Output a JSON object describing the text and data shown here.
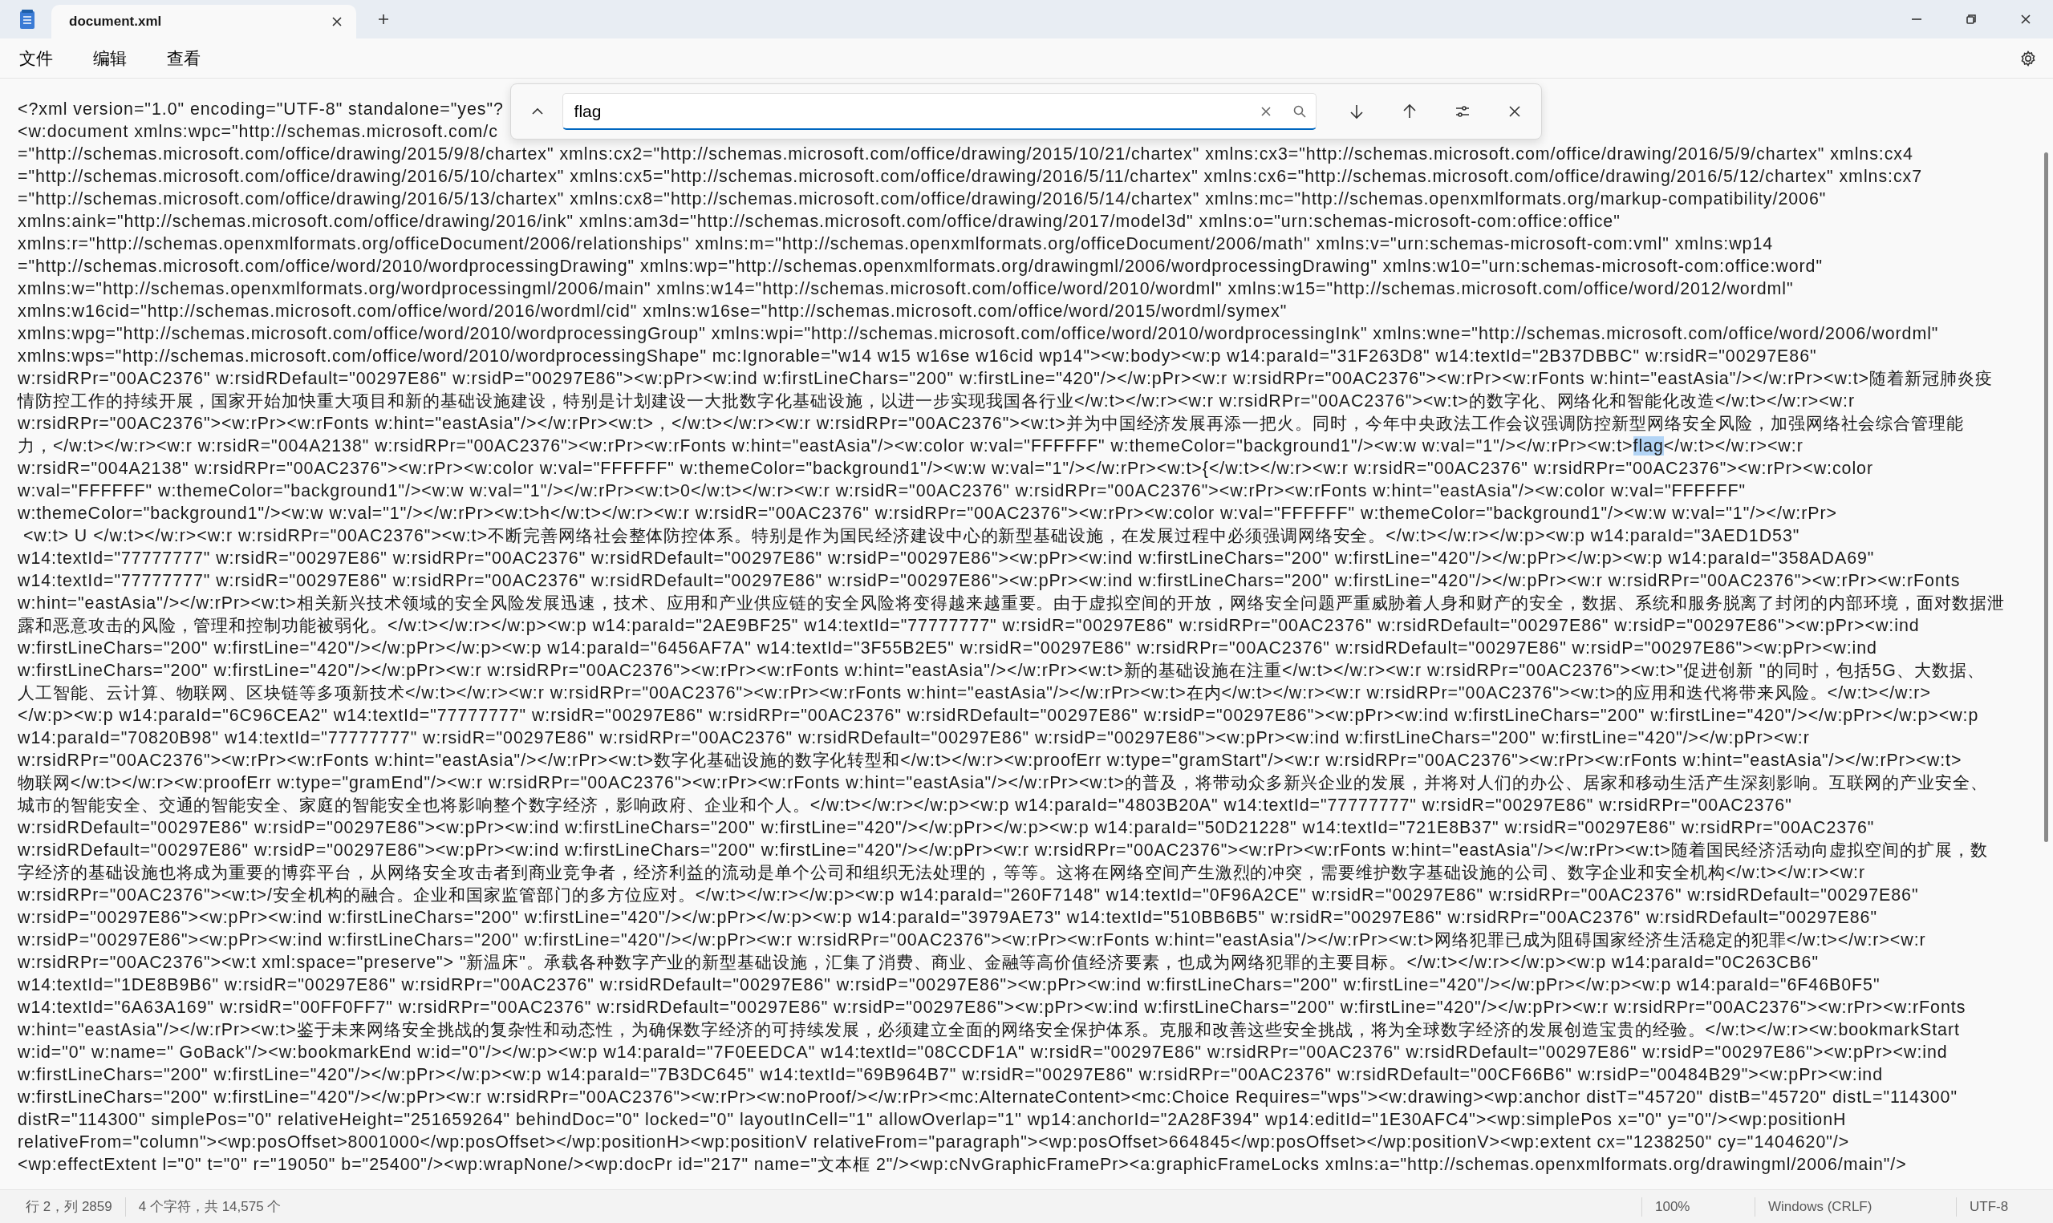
{
  "window": {
    "tab_title": "document.xml"
  },
  "menu": [
    "文件",
    "编辑",
    "查看"
  ],
  "find": {
    "value": "flag"
  },
  "lines": [
    {
      "text": "<?xml version=\"1.0\" encoding=\"UTF-8\" standalone=\"yes\"?"
    },
    {
      "text": "<w:document xmlns:wpc=\"http://schemas.microsoft.com/c"
    },
    {
      "text": "=\"http://schemas.microsoft.com/office/drawing/2015/9/8/chartex\" xmlns:cx2=\"http://schemas.microsoft.com/office/drawing/2015/10/21/chartex\" xmlns:cx3=\"http://schemas.microsoft.com/office/drawing/2016/5/9/chartex\" xmlns:cx4"
    },
    {
      "text": "=\"http://schemas.microsoft.com/office/drawing/2016/5/10/chartex\" xmlns:cx5=\"http://schemas.microsoft.com/office/drawing/2016/5/11/chartex\" xmlns:cx6=\"http://schemas.microsoft.com/office/drawing/2016/5/12/chartex\" xmlns:cx7"
    },
    {
      "text": "=\"http://schemas.microsoft.com/office/drawing/2016/5/13/chartex\" xmlns:cx8=\"http://schemas.microsoft.com/office/drawing/2016/5/14/chartex\" xmlns:mc=\"http://schemas.openxmlformats.org/markup-compatibility/2006\""
    },
    {
      "text": "xmlns:aink=\"http://schemas.microsoft.com/office/drawing/2016/ink\" xmlns:am3d=\"http://schemas.microsoft.com/office/drawing/2017/model3d\" xmlns:o=\"urn:schemas-microsoft-com:office:office\""
    },
    {
      "text": "xmlns:r=\"http://schemas.openxmlformats.org/officeDocument/2006/relationships\" xmlns:m=\"http://schemas.openxmlformats.org/officeDocument/2006/math\" xmlns:v=\"urn:schemas-microsoft-com:vml\" xmlns:wp14"
    },
    {
      "text": "=\"http://schemas.microsoft.com/office/word/2010/wordprocessingDrawing\" xmlns:wp=\"http://schemas.openxmlformats.org/drawingml/2006/wordprocessingDrawing\" xmlns:w10=\"urn:schemas-microsoft-com:office:word\""
    },
    {
      "text": "xmlns:w=\"http://schemas.openxmlformats.org/wordprocessingml/2006/main\" xmlns:w14=\"http://schemas.microsoft.com/office/word/2010/wordml\" xmlns:w15=\"http://schemas.microsoft.com/office/word/2012/wordml\""
    },
    {
      "text": "xmlns:w16cid=\"http://schemas.microsoft.com/office/word/2016/wordml/cid\" xmlns:w16se=\"http://schemas.microsoft.com/office/word/2015/wordml/symex\""
    },
    {
      "text": "xmlns:wpg=\"http://schemas.microsoft.com/office/word/2010/wordprocessingGroup\" xmlns:wpi=\"http://schemas.microsoft.com/office/word/2010/wordprocessingInk\" xmlns:wne=\"http://schemas.microsoft.com/office/word/2006/wordml\""
    },
    {
      "text": "xmlns:wps=\"http://schemas.microsoft.com/office/word/2010/wordprocessingShape\" mc:Ignorable=\"w14 w15 w16se w16cid wp14\"><w:body><w:p w14:paraId=\"31F263D8\" w14:textId=\"2B37DBBC\" w:rsidR=\"00297E86\""
    },
    {
      "text": "w:rsidRPr=\"00AC2376\" w:rsidRDefault=\"00297E86\" w:rsidP=\"00297E86\"><w:pPr><w:ind w:firstLineChars=\"200\" w:firstLine=\"420\"/></w:pPr><w:r w:rsidRPr=\"00AC2376\"><w:rPr><w:rFonts w:hint=\"eastAsia\"/></w:rPr><w:t>随着新冠肺炎疫"
    },
    {
      "text": "情防控工作的持续开展，国家开始加快重大项目和新的基础设施建设，特别是计划建设一大批数字化基础设施，以进一步实现我国各行业</w:t></w:r><w:r w:rsidRPr=\"00AC2376\"><w:t>的数字化、网络化和智能化改造</w:t></w:r><w:r"
    },
    {
      "text": "w:rsidRPr=\"00AC2376\"><w:rPr><w:rFonts w:hint=\"eastAsia\"/></w:rPr><w:t>，</w:t></w:r><w:r w:rsidRPr=\"00AC2376\"><w:t>并为中国经济发展再添一把火。同时，今年中央政法工作会议强调防控新型网络安全风险，加强网络社会综合管理能"
    },
    {
      "text": "力，</w:t></w:r><w:r w:rsidR=\"004A2138\" w:rsidRPr=\"00AC2376\"><w:rPr><w:rFonts w:hint=\"eastAsia\"/><w:color w:val=\"FFFFFF\" w:themeColor=\"background1\"/><w:w w:val=\"1\"/></w:rPr><w:t>",
      "match": "flag",
      "rest": "</w:t></w:r><w:r"
    },
    {
      "text": "w:rsidR=\"004A2138\" w:rsidRPr=\"00AC2376\"><w:rPr><w:color w:val=\"FFFFFF\" w:themeColor=\"background1\"/><w:w w:val=\"1\"/></w:rPr><w:t>{</w:t></w:r><w:r w:rsidR=\"00AC2376\" w:rsidRPr=\"00AC2376\"><w:rPr><w:color"
    },
    {
      "text": "w:val=\"FFFFFF\" w:themeColor=\"background1\"/><w:w w:val=\"1\"/></w:rPr><w:t>0</w:t></w:r><w:r w:rsidR=\"00AC2376\" w:rsidRPr=\"00AC2376\"><w:rPr><w:rFonts w:hint=\"eastAsia\"/><w:color w:val=\"FFFFFF\""
    },
    {
      "text": "w:themeColor=\"background1\"/><w:w w:val=\"1\"/></w:rPr><w:t>h</w:t></w:r><w:r w:rsidR=\"00AC2376\" w:rsidRPr=\"00AC2376\"><w:rPr><w:color w:val=\"FFFFFF\" w:themeColor=\"background1\"/><w:w w:val=\"1\"/></w:rPr>"
    },
    {
      "text": " <w:t> U </w:t></w:r><w:r w:rsidRPr=\"00AC2376\"><w:t>不断完善网络社会整体防控体系。特别是作为国民经济建设中心的新型基础设施，在发展过程中必须强调网络安全。</w:t></w:r></w:p><w:p w14:paraId=\"3AED1D53\""
    },
    {
      "text": "w14:textId=\"77777777\" w:rsidR=\"00297E86\" w:rsidRPr=\"00AC2376\" w:rsidRDefault=\"00297E86\" w:rsidP=\"00297E86\"><w:pPr><w:ind w:firstLineChars=\"200\" w:firstLine=\"420\"/></w:pPr></w:p><w:p w14:paraId=\"358ADA69\""
    },
    {
      "text": "w14:textId=\"77777777\" w:rsidR=\"00297E86\" w:rsidRPr=\"00AC2376\" w:rsidRDefault=\"00297E86\" w:rsidP=\"00297E86\"><w:pPr><w:ind w:firstLineChars=\"200\" w:firstLine=\"420\"/></w:pPr><w:r w:rsidRPr=\"00AC2376\"><w:rPr><w:rFonts"
    },
    {
      "text": "w:hint=\"eastAsia\"/></w:rPr><w:t>相关新兴技术领域的安全风险发展迅速，技术、应用和产业供应链的安全风险将变得越来越重要。由于虚拟空间的开放，网络安全问题严重威胁着人身和财产的安全，数据、系统和服务脱离了封闭的内部环境，面对数据泄"
    },
    {
      "text": "露和恶意攻击的风险，管理和控制功能被弱化。</w:t></w:r></w:p><w:p w14:paraId=\"2AE9BF25\" w14:textId=\"77777777\" w:rsidR=\"00297E86\" w:rsidRPr=\"00AC2376\" w:rsidRDefault=\"00297E86\" w:rsidP=\"00297E86\"><w:pPr><w:ind"
    },
    {
      "text": "w:firstLineChars=\"200\" w:firstLine=\"420\"/></w:pPr></w:p><w:p w14:paraId=\"6456AF7A\" w14:textId=\"3F55B2E5\" w:rsidR=\"00297E86\" w:rsidRPr=\"00AC2376\" w:rsidRDefault=\"00297E86\" w:rsidP=\"00297E86\"><w:pPr><w:ind"
    },
    {
      "text": "w:firstLineChars=\"200\" w:firstLine=\"420\"/></w:pPr><w:r w:rsidRPr=\"00AC2376\"><w:rPr><w:rFonts w:hint=\"eastAsia\"/></w:rPr><w:t>新的基础设施在注重</w:t></w:r><w:r w:rsidRPr=\"00AC2376\"><w:t>\"促进创新 \"的同时，包括5G、大数据、"
    },
    {
      "text": "人工智能、云计算、物联网、区块链等多项新技术</w:t></w:r><w:r w:rsidRPr=\"00AC2376\"><w:rPr><w:rFonts w:hint=\"eastAsia\"/></w:rPr><w:t>在内</w:t></w:r><w:r w:rsidRPr=\"00AC2376\"><w:t>的应用和迭代将带来风险。</w:t></w:r>"
    },
    {
      "text": "</w:p><w:p w14:paraId=\"6C96CEA2\" w14:textId=\"77777777\" w:rsidR=\"00297E86\" w:rsidRPr=\"00AC2376\" w:rsidRDefault=\"00297E86\" w:rsidP=\"00297E86\"><w:pPr><w:ind w:firstLineChars=\"200\" w:firstLine=\"420\"/></w:pPr></w:p><w:p"
    },
    {
      "text": "w14:paraId=\"70820B98\" w14:textId=\"77777777\" w:rsidR=\"00297E86\" w:rsidRPr=\"00AC2376\" w:rsidRDefault=\"00297E86\" w:rsidP=\"00297E86\"><w:pPr><w:ind w:firstLineChars=\"200\" w:firstLine=\"420\"/></w:pPr><w:r"
    },
    {
      "text": "w:rsidRPr=\"00AC2376\"><w:rPr><w:rFonts w:hint=\"eastAsia\"/></w:rPr><w:t>数字化基础设施的数字化转型和</w:t></w:r><w:proofErr w:type=\"gramStart\"/><w:r w:rsidRPr=\"00AC2376\"><w:rPr><w:rFonts w:hint=\"eastAsia\"/></w:rPr><w:t>"
    },
    {
      "text": "物联网</w:t></w:r><w:proofErr w:type=\"gramEnd\"/><w:r w:rsidRPr=\"00AC2376\"><w:rPr><w:rFonts w:hint=\"eastAsia\"/></w:rPr><w:t>的普及，将带动众多新兴企业的发展，并将对人们的办公、居家和移动生活产生深刻影响。互联网的产业安全、"
    },
    {
      "text": "城市的智能安全、交通的智能安全、家庭的智能安全也将影响整个数字经济，影响政府、企业和个人。</w:t></w:r></w:p><w:p w14:paraId=\"4803B20A\" w14:textId=\"77777777\" w:rsidR=\"00297E86\" w:rsidRPr=\"00AC2376\""
    },
    {
      "text": "w:rsidRDefault=\"00297E86\" w:rsidP=\"00297E86\"><w:pPr><w:ind w:firstLineChars=\"200\" w:firstLine=\"420\"/></w:pPr></w:p><w:p w14:paraId=\"50D21228\" w14:textId=\"721E8B37\" w:rsidR=\"00297E86\" w:rsidRPr=\"00AC2376\""
    },
    {
      "text": "w:rsidRDefault=\"00297E86\" w:rsidP=\"00297E86\"><w:pPr><w:ind w:firstLineChars=\"200\" w:firstLine=\"420\"/></w:pPr><w:r w:rsidRPr=\"00AC2376\"><w:rPr><w:rFonts w:hint=\"eastAsia\"/></w:rPr><w:t>随着国民经济活动向虚拟空间的扩展，数"
    },
    {
      "text": "字经济的基础设施也将成为重要的博弈平台，从网络安全攻击者到商业竞争者，经济利益的流动是单个公司和组织无法处理的，等等。这将在网络空间产生激烈的冲突，需要维护数字基础设施的公司、数字企业和安全机构</w:t></w:r><w:r"
    },
    {
      "text": "w:rsidRPr=\"00AC2376\"><w:t>/安全机构的融合。企业和国家监管部门的多方位应对。</w:t></w:r></w:p><w:p w14:paraId=\"260F7148\" w14:textId=\"0F96A2CE\" w:rsidR=\"00297E86\" w:rsidRPr=\"00AC2376\" w:rsidRDefault=\"00297E86\""
    },
    {
      "text": "w:rsidP=\"00297E86\"><w:pPr><w:ind w:firstLineChars=\"200\" w:firstLine=\"420\"/></w:pPr></w:p><w:p w14:paraId=\"3979AE73\" w14:textId=\"510BB6B5\" w:rsidR=\"00297E86\" w:rsidRPr=\"00AC2376\" w:rsidRDefault=\"00297E86\""
    },
    {
      "text": "w:rsidP=\"00297E86\"><w:pPr><w:ind w:firstLineChars=\"200\" w:firstLine=\"420\"/></w:pPr><w:r w:rsidRPr=\"00AC2376\"><w:rPr><w:rFonts w:hint=\"eastAsia\"/></w:rPr><w:t>网络犯罪已成为阻碍国家经济生活稳定的犯罪</w:t></w:r><w:r"
    },
    {
      "text": "w:rsidRPr=\"00AC2376\"><w:t xml:space=\"preserve\"> \"新温床\"。承载各种数字产业的新型基础设施，汇集了消费、商业、金融等高价值经济要素，也成为网络犯罪的主要目标。</w:t></w:r></w:p><w:p w14:paraId=\"0C263CB6\""
    },
    {
      "text": "w14:textId=\"1DE8B9B6\" w:rsidR=\"00297E86\" w:rsidRPr=\"00AC2376\" w:rsidRDefault=\"00297E86\" w:rsidP=\"00297E86\"><w:pPr><w:ind w:firstLineChars=\"200\" w:firstLine=\"420\"/></w:pPr></w:p><w:p w14:paraId=\"6F46B0F5\""
    },
    {
      "text": "w14:textId=\"6A63A169\" w:rsidR=\"00FF0FF7\" w:rsidRPr=\"00AC2376\" w:rsidRDefault=\"00297E86\" w:rsidP=\"00297E86\"><w:pPr><w:ind w:firstLineChars=\"200\" w:firstLine=\"420\"/></w:pPr><w:r w:rsidRPr=\"00AC2376\"><w:rPr><w:rFonts"
    },
    {
      "text": "w:hint=\"eastAsia\"/></w:rPr><w:t>鉴于未来网络安全挑战的复杂性和动态性，为确保数字经济的可持续发展，必须建立全面的网络安全保护体系。克服和改善这些安全挑战，将为全球数字经济的发展创造宝贵的经验。</w:t></w:r><w:bookmarkStart"
    },
    {
      "text": "w:id=\"0\" w:name=\" GoBack\"/><w:bookmarkEnd w:id=\"0\"/></w:p><w:p w14:paraId=\"7F0EEDCA\" w14:textId=\"08CCDF1A\" w:rsidR=\"00297E86\" w:rsidRPr=\"00AC2376\" w:rsidRDefault=\"00297E86\" w:rsidP=\"00297E86\"><w:pPr><w:ind"
    },
    {
      "text": "w:firstLineChars=\"200\" w:firstLine=\"420\"/></w:pPr></w:p><w:p w14:paraId=\"7B3DC645\" w14:textId=\"69B964B7\" w:rsidR=\"00297E86\" w:rsidRPr=\"00AC2376\" w:rsidRDefault=\"00CF66B6\" w:rsidP=\"00484B29\"><w:pPr><w:ind"
    },
    {
      "text": "w:firstLineChars=\"200\" w:firstLine=\"420\"/></w:pPr><w:r w:rsidRPr=\"00AC2376\"><w:rPr><w:noProof/></w:rPr><mc:AlternateContent><mc:Choice Requires=\"wps\"><w:drawing><wp:anchor distT=\"45720\" distB=\"45720\" distL=\"114300\""
    },
    {
      "text": "distR=\"114300\" simplePos=\"0\" relativeHeight=\"251659264\" behindDoc=\"0\" locked=\"0\" layoutInCell=\"1\" allowOverlap=\"1\" wp14:anchorId=\"2A28F394\" wp14:editId=\"1E30AFC4\"><wp:simplePos x=\"0\" y=\"0\"/><wp:positionH"
    },
    {
      "text": "relativeFrom=\"column\"><wp:posOffset>8001000</wp:posOffset></wp:positionH><wp:positionV relativeFrom=\"paragraph\"><wp:posOffset>664845</wp:posOffset></wp:positionV><wp:extent cx=\"1238250\" cy=\"1404620\"/>"
    },
    {
      "text": "<wp:effectExtent l=\"0\" t=\"0\" r=\"19050\" b=\"25400\"/><wp:wrapNone/><wp:docPr id=\"217\" name=\"文本框 2\"/><wp:cNvGraphicFramePr><a:graphicFrameLocks xmlns:a=\"http://schemas.openxmlformats.org/drawingml/2006/main\"/>"
    }
  ],
  "status_bar": {
    "position": "行 2，列 2859",
    "selection": "4 个字符，共 14,575 个",
    "zoom": "100%",
    "line_ending": "Windows (CRLF)",
    "encoding": "UTF-8"
  }
}
